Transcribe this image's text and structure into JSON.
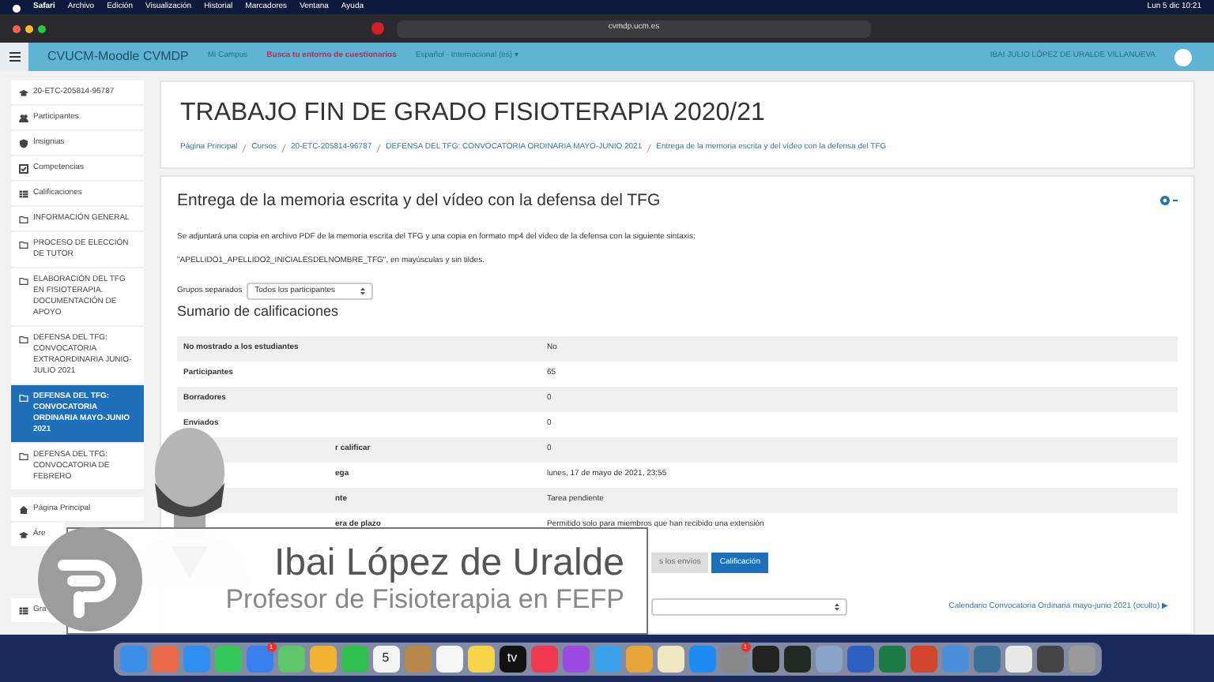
{
  "menubar": {
    "items": [
      "Safari",
      "Archivo",
      "Edición",
      "Visualización",
      "Historial",
      "Marcadores",
      "Ventana",
      "Ayuda"
    ],
    "clock": "Lun 5 dic 10:21"
  },
  "browser": {
    "url": "cvmdp.ucm.es"
  },
  "navbar": {
    "brand": "CVUCM-Moodle CVMDP",
    "links": [
      {
        "text": "Mi Campus",
        "kind": "plain"
      },
      {
        "text": "Busca tu entorno de cuestionarios",
        "kind": "alert"
      },
      {
        "text": "Español - Internacional (es) ▾",
        "kind": "plain"
      }
    ],
    "user": "IBAI JULIO LÓPEZ DE URALDE VILLANUEVA"
  },
  "sidebar": {
    "items": [
      {
        "text": "20-ETC-205814-96787",
        "kind": "course",
        "selected": false
      },
      {
        "text": "Participantes",
        "kind": "people",
        "selected": false
      },
      {
        "text": "Insignias",
        "kind": "badge",
        "selected": false
      },
      {
        "text": "Competencias",
        "kind": "check",
        "selected": false
      },
      {
        "text": "Calificaciones",
        "kind": "grades",
        "selected": false
      },
      {
        "text": "INFORMACIÓN GENERAL",
        "kind": "folder",
        "selected": false
      },
      {
        "text": "PROCESO DE ELECCIÓN DE TUTOR",
        "kind": "folder",
        "selected": false
      },
      {
        "text": "ELABORACIÓN DEL TFG EN FISIOTERAPIA. DOCUMENTACIÓN DE APOYO",
        "kind": "folder",
        "selected": false
      },
      {
        "text": "DEFENSA DEL TFG: CONVOCATORIA EXTRAORDINARIA JUNIO-JULIO 2021",
        "kind": "folder",
        "selected": false
      },
      {
        "text": "DEFENSA DEL TFG: CONVOCATORIA ORDINARIA MAYO-JUNIO 2021",
        "kind": "folder",
        "selected": true
      },
      {
        "text": "DEFENSA DEL TFG: CONVOCATORIA DE FEBRERO",
        "kind": "folder",
        "selected": false
      }
    ],
    "bottom_items": [
      {
        "text": "Página Principal",
        "kind": "home",
        "selected": false
      },
      {
        "text": "Áre",
        "kind": "course",
        "selected": false
      },
      {
        "text": "Gra",
        "kind": "grades",
        "selected": false
      }
    ]
  },
  "page": {
    "title": "TRABAJO FIN DE GRADO FISIOTERAPIA 2020/21",
    "breadcrumb": [
      "Página Principal",
      "Cursos",
      "20-ETC-205814-96787",
      "DEFENSA DEL TFG: CONVOCATORIA ORDINARIA MAYO-JUNIO 2021",
      "Entrega de la memoria escrita y del vídeo con la defensa del TFG"
    ]
  },
  "assignment": {
    "heading": "Entrega de la memoria escrita y del vídeo con la defensa del TFG",
    "description": [
      "Se adjuntará una copia en archivo PDF de la memoria escrita del TFG y una copia en formato mp4 del vídeo de la defensa con la siguiente sintaxis:",
      "\"APELLIDO1_APELLIDO2_INICIALESDELNOMBRE_TFG\", en mayúsculas y sin tildes."
    ],
    "groups_label": "Grupos separados",
    "groups_value": "Todos los participantes",
    "summary_title": "Sumario de calificaciones",
    "rows": [
      {
        "label": "No mostrado a los estudiantes",
        "value": "No"
      },
      {
        "label": "Participantes",
        "value": "65"
      },
      {
        "label": "Borradores",
        "value": "0"
      },
      {
        "label": "Enviados",
        "value": "0"
      },
      {
        "label": "r calificar",
        "value": "0"
      },
      {
        "label": "ega",
        "value": "lunes, 17 de mayo de 2021, 23:55"
      },
      {
        "label": "nte",
        "value": "Tarea pendiente"
      },
      {
        "label": "era de plazo",
        "value": "Permitido solo para miembros que han recibido una extensión"
      }
    ],
    "buttons": [
      {
        "text": "s los envíos",
        "kind": "secondary"
      },
      {
        "text": "Calificación",
        "kind": "primary"
      }
    ],
    "next_link": "Calendario Convocatoria Ordinaria mayo-junio 2021 (oculto) ▶"
  },
  "overlay": {
    "name": "Ibai López de Uralde",
    "role": "Profesor de Fisioterapia en FEFP"
  },
  "dock": [
    {
      "color": "#3b8ee8"
    },
    {
      "color": "#e86a4a"
    },
    {
      "color": "#2f8ef0"
    },
    {
      "color": "#34c759"
    },
    {
      "color": "#3a7ff0",
      "badge": "1"
    },
    {
      "color": "#5fc46a"
    },
    {
      "color": "#f2b233"
    },
    {
      "color": "#2fbf4f"
    },
    {
      "color": "#f4f4f4",
      "label": "5"
    },
    {
      "color": "#b7884a"
    },
    {
      "color": "#f6f6f6"
    },
    {
      "color": "#f5d44a"
    },
    {
      "color": "#111111",
      "label": "tv"
    },
    {
      "color": "#f0384e"
    },
    {
      "color": "#9b4be0"
    },
    {
      "color": "#3aa0e8"
    },
    {
      "color": "#e8a53a"
    },
    {
      "color": "#f0e7c0"
    },
    {
      "color": "#1c8cf2"
    },
    {
      "color": "#888888",
      "badge": "1"
    },
    {
      "color": "#222222"
    },
    {
      "color": "#1e2a22"
    },
    {
      "color": "#8aa4c8"
    },
    {
      "color": "#2b5fbf"
    },
    {
      "color": "#1d7a45"
    },
    {
      "color": "#d0452b"
    },
    {
      "color": "#4a8fd8"
    },
    {
      "color": "#3a6f9a"
    },
    {
      "color": "#e8e8e8"
    },
    {
      "color": "#444444"
    },
    {
      "color": "#9a9a9a"
    }
  ]
}
